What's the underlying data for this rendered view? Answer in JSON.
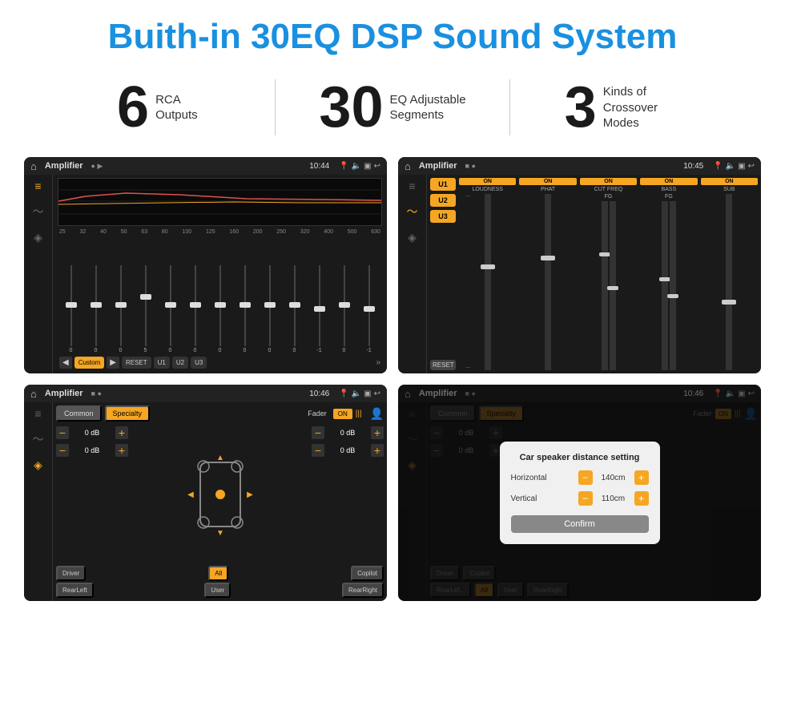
{
  "header": {
    "title": "Buith-in 30EQ DSP Sound System"
  },
  "stats": [
    {
      "number": "6",
      "label": "RCA\nOutputs"
    },
    {
      "number": "30",
      "label": "EQ Adjustable\nSegments"
    },
    {
      "number": "3",
      "label": "Kinds of\nCrossover Modes"
    }
  ],
  "screens": {
    "eq": {
      "app_name": "Amplifier",
      "time": "10:44",
      "freq_labels": [
        "25",
        "32",
        "40",
        "50",
        "63",
        "80",
        "100",
        "125",
        "160",
        "200",
        "250",
        "320",
        "400",
        "500",
        "630"
      ],
      "slider_values": [
        "0",
        "0",
        "0",
        "5",
        "0",
        "0",
        "0",
        "0",
        "0",
        "0",
        "-1",
        "0",
        "-1"
      ],
      "buttons": {
        "custom": "Custom",
        "reset": "RESET",
        "u1": "U1",
        "u2": "U2",
        "u3": "U3"
      }
    },
    "crossover": {
      "app_name": "Amplifier",
      "time": "10:45",
      "u_buttons": [
        "U1",
        "U2",
        "U3"
      ],
      "channels": [
        {
          "header": "ON",
          "name": "LOUDNESS",
          "sub": ""
        },
        {
          "header": "ON",
          "name": "PHAT",
          "sub": ""
        },
        {
          "header": "ON",
          "name": "CUT FREQ",
          "sub": ""
        },
        {
          "header": "ON",
          "name": "BASS",
          "sub": ""
        },
        {
          "header": "ON",
          "name": "SUB",
          "sub": ""
        }
      ],
      "reset": "RESET"
    },
    "fader": {
      "app_name": "Amplifier",
      "time": "10:46",
      "tabs": [
        "Common",
        "Specialty"
      ],
      "active_tab": "Specialty",
      "fader_label": "Fader",
      "fader_on": "ON",
      "db_values": [
        "0 dB",
        "0 dB",
        "0 dB",
        "0 dB"
      ],
      "buttons": {
        "driver": "Driver",
        "copilot": "Copilot",
        "rear_left": "RearLeft",
        "all": "All",
        "user": "User",
        "rear_right": "RearRight"
      }
    },
    "dialog": {
      "app_name": "Amplifier",
      "time": "10:46",
      "tabs": [
        "Common",
        "Specialty"
      ],
      "active_tab": "Specialty",
      "fader_label": "Fader",
      "dialog_title": "Car speaker distance setting",
      "horizontal_label": "Horizontal",
      "horizontal_value": "140cm",
      "vertical_label": "Vertical",
      "vertical_value": "110cm",
      "confirm_label": "Confirm",
      "db_values": [
        "0 dB",
        "0 dB"
      ],
      "buttons": {
        "driver": "Driver",
        "copilot": "Copilot",
        "rear_left": "RearLef...",
        "all": "All",
        "user": "User",
        "rear_right": "RearRight"
      }
    }
  }
}
